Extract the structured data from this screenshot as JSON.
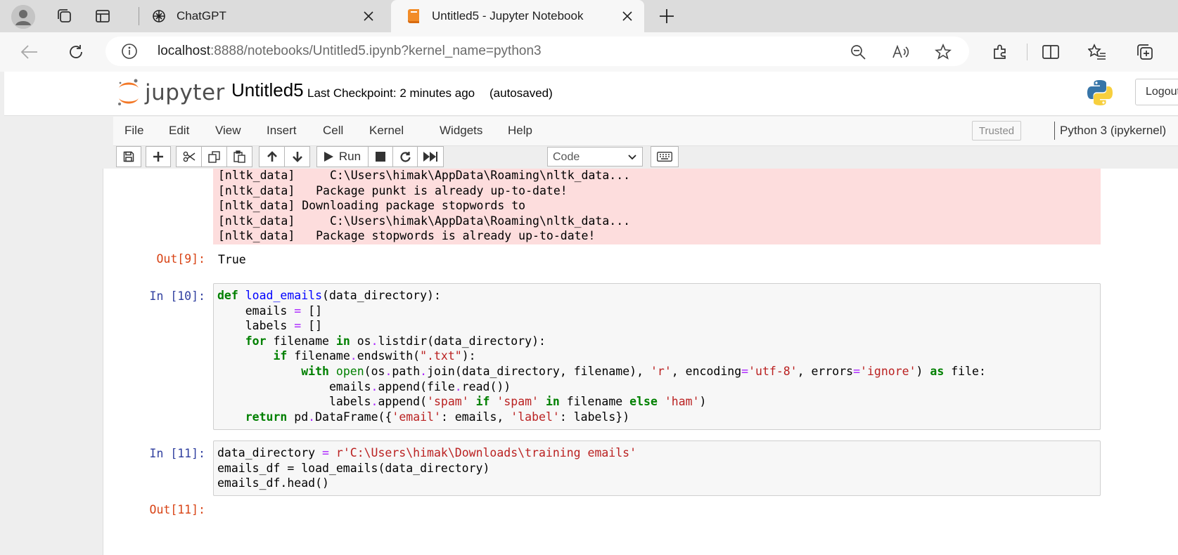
{
  "browser": {
    "tabs": [
      {
        "title": "ChatGPT",
        "active": false
      },
      {
        "title": "Untitled5 - Jupyter Notebook",
        "active": true
      }
    ],
    "url_host": "localhost",
    "url_rest": ":8888/notebooks/Untitled5.ipynb?kernel_name=python3"
  },
  "jupyter": {
    "logo_text": "jupyter",
    "notebook_title": "Untitled5",
    "checkpoint": "Last Checkpoint: 2 minutes ago",
    "autosaved": "(autosaved)",
    "logout": "Logout",
    "menu": [
      "File",
      "Edit",
      "View",
      "Insert",
      "Cell",
      "Kernel",
      "Widgets",
      "Help"
    ],
    "trusted": "Trusted",
    "kernel": "Python 3 (ipykernel)",
    "run_label": "Run",
    "cell_type": "Code"
  },
  "cells": {
    "stderr_lines": [
      "[nltk_data]     C:\\Users\\himak\\AppData\\Roaming\\nltk_data...",
      "[nltk_data]   Package punkt is already up-to-date!",
      "[nltk_data] Downloading package stopwords to",
      "[nltk_data]     C:\\Users\\himak\\AppData\\Roaming\\nltk_data...",
      "[nltk_data]   Package stopwords is already up-to-date!"
    ],
    "out9_prompt": "Out[9]:",
    "out9_value": "True",
    "in10_prompt": "In [10]:",
    "in11_prompt": "In [11]:",
    "out11_prompt": "Out[11]:",
    "in11_code": {
      "line1_var": "data_directory ",
      "line1_eq": "=",
      "line1_str": " r'C:\\Users\\himak\\Downloads\\training emails'",
      "line2": "emails_df = load_emails(data_directory)",
      "line3": "emails_df.head()"
    }
  }
}
